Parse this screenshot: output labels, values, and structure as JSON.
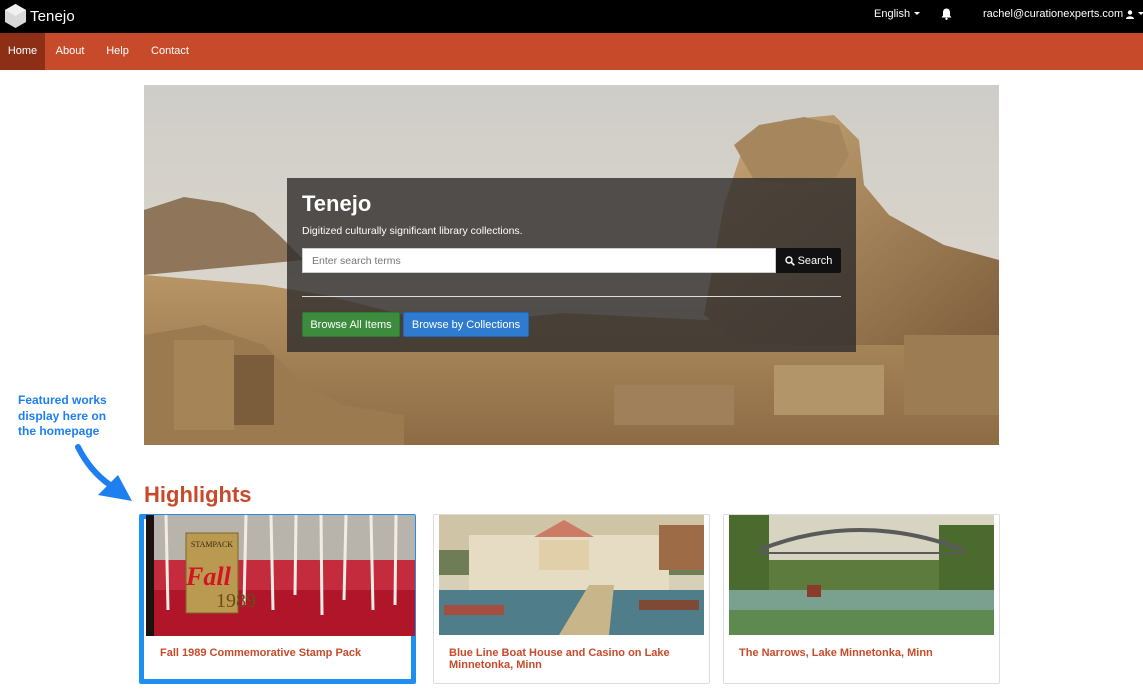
{
  "topbar": {
    "brand": "Tenejo",
    "brand_icon": "hexagon-logo-icon",
    "language": "English",
    "notifications_icon": "bell-icon",
    "user_email": "rachel@curationexperts.com",
    "user_icon": "user-icon"
  },
  "nav": {
    "items": [
      {
        "label": "Home",
        "active": true
      },
      {
        "label": "About",
        "active": false
      },
      {
        "label": "Help",
        "active": false
      },
      {
        "label": "Contact",
        "active": false
      }
    ]
  },
  "hero": {
    "title": "Tenejo",
    "subtitle": "Digitized culturally significant library collections.",
    "search_placeholder": "Enter search terms",
    "search_button": "Search",
    "search_icon": "magnifier-icon",
    "browse_all": "Browse All Items",
    "browse_collections": "Browse by Collections"
  },
  "annotation": {
    "text_lines": [
      "Featured works",
      "display here on",
      "the homepage"
    ],
    "color": "#1d7ff0"
  },
  "highlights": {
    "title": "Highlights",
    "cards": [
      {
        "title": "Fall 1989 Commemorative Stamp Pack",
        "featured": true
      },
      {
        "title": "Blue Line Boat House and Casino on Lake Minnetonka, Minn",
        "featured": false
      },
      {
        "title": "The Narrows, Lake Minnetonka, Minn",
        "featured": false
      }
    ]
  },
  "colors": {
    "nav_bg": "#c74b2a",
    "nav_active": "#8d2f16",
    "accent_text": "#c74b2a",
    "browse_all_btn": "#3d8b3d",
    "browse_collections_btn": "#2e7bcf",
    "featured_border": "#1d8ff0"
  }
}
